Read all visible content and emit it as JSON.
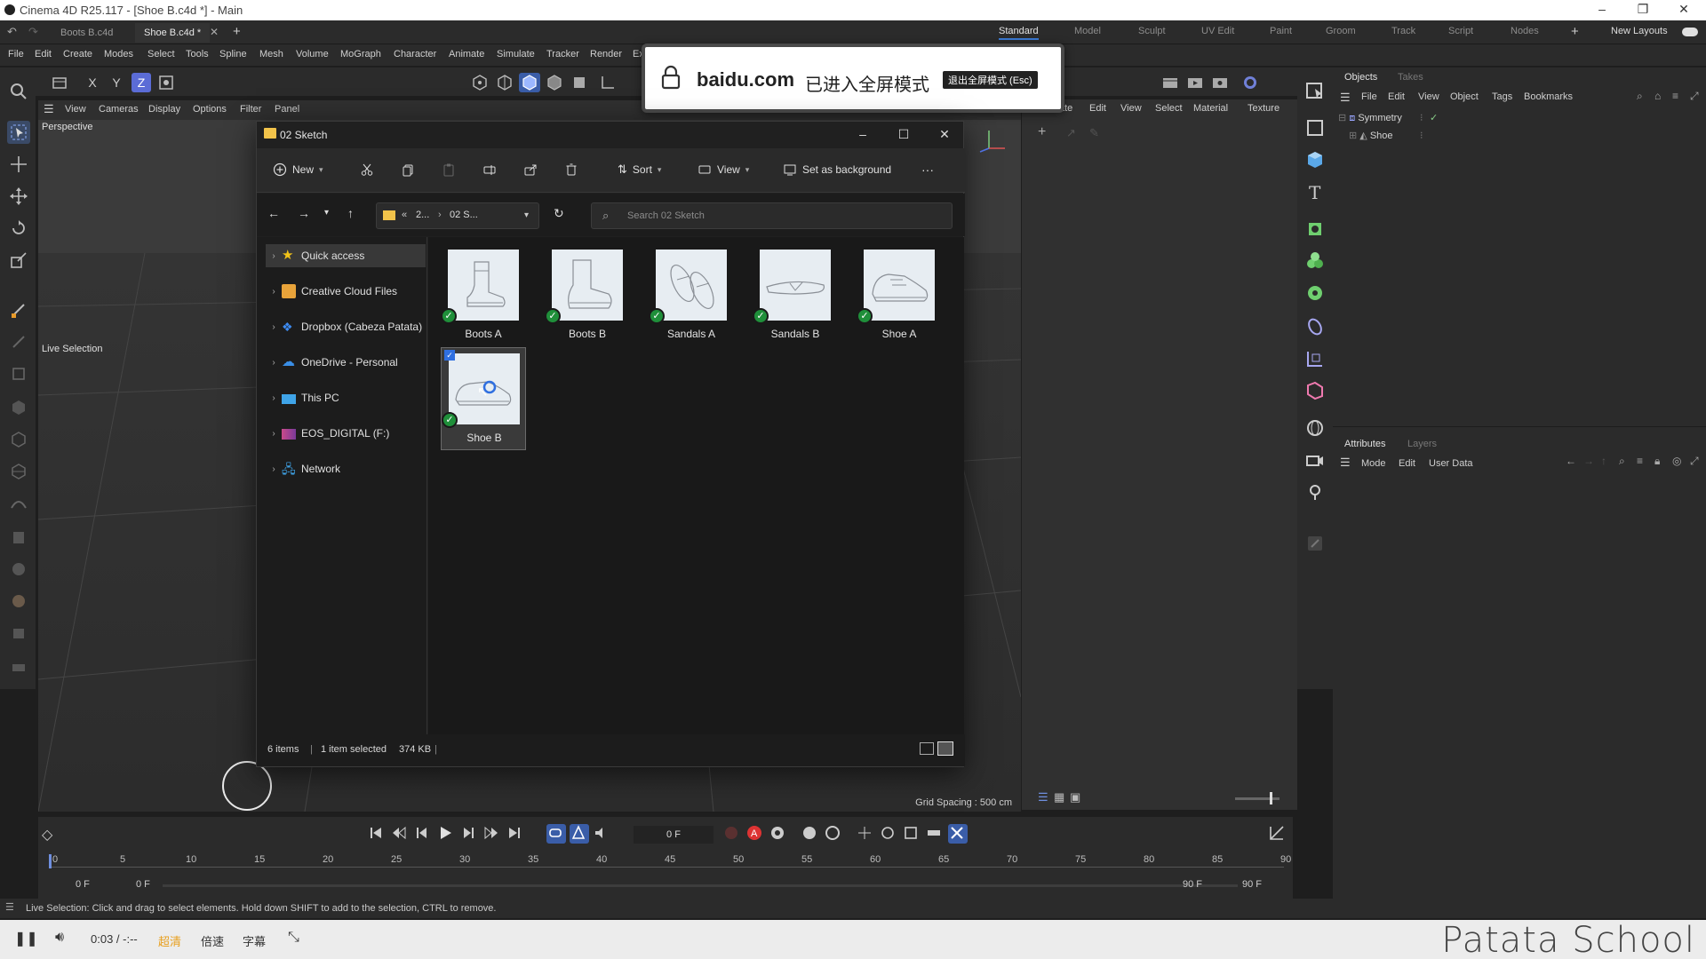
{
  "app": {
    "title": "Cinema 4D R25.117 - [Shoe B.c4d *] - Main",
    "doc_tabs": [
      "Boots B.c4d",
      "Shoe B.c4d *"
    ],
    "layouts": [
      "Standard",
      "Model",
      "Sculpt",
      "UV Edit",
      "Paint",
      "Groom",
      "Track",
      "Script",
      "Nodes"
    ],
    "new_layouts": "New Layouts",
    "menu": [
      "File",
      "Edit",
      "Create",
      "Modes",
      "Select",
      "Tools",
      "Spline",
      "Mesh",
      "Volume",
      "MoGraph",
      "Character",
      "Animate",
      "Simulate",
      "Tracker",
      "Render",
      "Ex"
    ]
  },
  "viewport": {
    "menu": [
      "View",
      "Cameras",
      "Display",
      "Options",
      "Filter",
      "Panel"
    ],
    "camera_label": "Perspective",
    "tool_label": "Live Selection",
    "grid_spacing": "Grid Spacing : 500 cm"
  },
  "material_manager": {
    "menu": [
      "ate",
      "Edit",
      "View",
      "Select",
      "Material",
      "Texture"
    ]
  },
  "objects_panel": {
    "tabs": [
      "Objects",
      "Takes"
    ],
    "menu": [
      "File",
      "Edit",
      "View",
      "Object",
      "Tags",
      "Bookmarks"
    ],
    "rows": [
      "Symmetry",
      "Shoe"
    ]
  },
  "attributes_panel": {
    "tabs": [
      "Attributes",
      "Layers"
    ],
    "menu": [
      "Mode",
      "Edit",
      "User Data"
    ]
  },
  "timeline": {
    "current_frame": "0 F",
    "ticks": [
      "0",
      "5",
      "10",
      "15",
      "20",
      "25",
      "30",
      "35",
      "40",
      "45",
      "50",
      "55",
      "60",
      "65",
      "70",
      "75",
      "80",
      "85",
      "90"
    ],
    "start": "0 F",
    "start2": "0 F",
    "end": "90 F",
    "end2": "90 F"
  },
  "status": {
    "text": "Live Selection: Click and drag to select elements. Hold down SHIFT to add to the selection, CTRL to remove."
  },
  "fullscreen_notice": {
    "host": "baidu.com",
    "message": "已进入全屏模式",
    "exit_button": "退出全屏模式 (Esc)"
  },
  "explorer": {
    "title": "02 Sketch",
    "toolbar": {
      "new": "New",
      "sort": "Sort",
      "view": "View",
      "set_background": "Set as background",
      "more": "···"
    },
    "address": {
      "prefix": "«",
      "crumb1": "2...",
      "sep": "›",
      "crumb2": "02 S..."
    },
    "search_placeholder": "Search 02 Sketch",
    "nav": [
      {
        "label": "Quick access",
        "icon": "star-icon",
        "color": "#f2c318"
      },
      {
        "label": "Creative Cloud Files",
        "icon": "creative-cloud-icon",
        "color": "#e8a33a"
      },
      {
        "label": "Dropbox (Cabeza Patata)",
        "icon": "dropbox-icon",
        "color": "#3d8bf2"
      },
      {
        "label": "OneDrive - Personal",
        "icon": "onedrive-icon",
        "color": "#3a8ee6"
      },
      {
        "label": "This PC",
        "icon": "pc-icon",
        "color": "#3fa4e8"
      },
      {
        "label": "EOS_DIGITAL (F:)",
        "icon": "drive-icon",
        "color": "#c84a8a"
      },
      {
        "label": "Network",
        "icon": "network-icon",
        "color": "#3fa4e8"
      }
    ],
    "files": [
      {
        "name": "Boots A",
        "synced": true
      },
      {
        "name": "Boots B",
        "synced": true
      },
      {
        "name": "Sandals A",
        "synced": true
      },
      {
        "name": "Sandals B",
        "synced": true
      },
      {
        "name": "Shoe A",
        "synced": true
      },
      {
        "name": "Shoe B",
        "synced": true,
        "selected": true
      }
    ],
    "status": {
      "count": "6 items",
      "sep": "|",
      "selection": "1 item selected",
      "size": "374 KB"
    }
  },
  "player": {
    "time": "0:03 / -:--",
    "quality": "超清",
    "speed": "倍速",
    "subtitles": "字幕",
    "watermark": "Patata School"
  },
  "colors": {
    "accent": "#3a7bd5",
    "sync_ok": "#1f8f3a",
    "bg": "#1e1e1e"
  }
}
